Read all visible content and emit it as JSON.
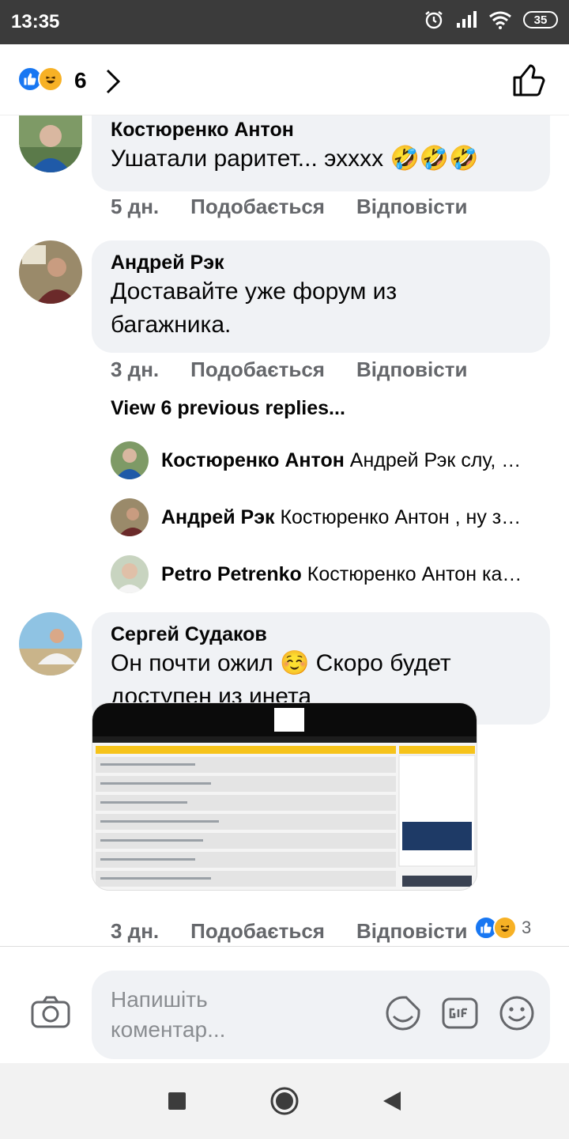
{
  "status": {
    "time": "13:35",
    "battery": "35"
  },
  "header": {
    "reaction_count": "6"
  },
  "comments": [
    {
      "name": "Костюренко Антон",
      "text": "Ушатали раритет... эхххх 🤣🤣🤣",
      "time": "5 дн.",
      "like": "Подобається",
      "reply": "Відповісти"
    },
    {
      "name": "Андрей Рэк",
      "text_line1": "Доставайте уже форум из",
      "text_line2": "багажника.",
      "time": "3 дн.",
      "like": "Подобається",
      "reply": "Відповісти"
    },
    {
      "name": "Сергей Судаков",
      "text_line1": "Он почти ожил ☺️ Скоро будет",
      "text_line2": "доступен из инета",
      "time": "3 дн.",
      "like": "Подобається",
      "reply": "Відповісти",
      "image_reaction_count": "3"
    }
  ],
  "view_previous": "View 6 previous replies...",
  "replies": [
    {
      "name": "Костюренко Антон",
      "text": "Андрей Рэк слу, …"
    },
    {
      "name": "Андрей Рэк",
      "text": "Костюренко Антон , ну з…"
    },
    {
      "name": "Petro Petrenko",
      "text": "Костюренко Антон ка…"
    }
  ],
  "composer": {
    "placeholder_line1": "Напишіть",
    "placeholder_line2": "коментар..."
  },
  "colors": {
    "bubble": "#f0f2f5",
    "meta": "#65676b",
    "like_blue": "#1877f2",
    "haha_yellow": "#f7b125"
  },
  "icons": [
    "like-icon",
    "haha-icon",
    "chevron-right-icon",
    "thumbs-up-icon",
    "camera-icon",
    "sticker-icon",
    "gif-icon",
    "emoji-icon"
  ]
}
